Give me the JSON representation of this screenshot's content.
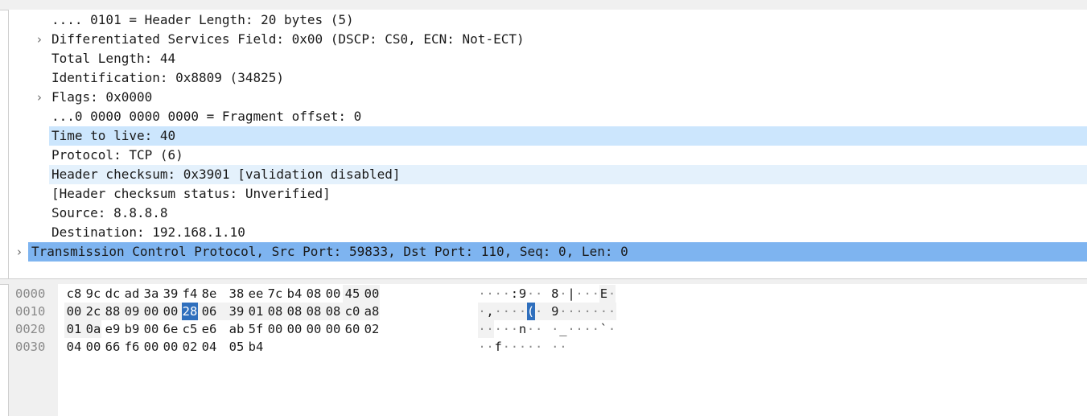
{
  "tree": {
    "rows": [
      {
        "text": ".... 0101 = Header Length: 20 bytes (5)",
        "expandable": false,
        "indent": 1,
        "hl": ""
      },
      {
        "text": "Differentiated Services Field: 0x00 (DSCP: CS0, ECN: Not-ECT)",
        "expandable": true,
        "indent": 1,
        "hl": ""
      },
      {
        "text": "Total Length: 44",
        "expandable": false,
        "indent": 1,
        "hl": ""
      },
      {
        "text": "Identification: 0x8809 (34825)",
        "expandable": false,
        "indent": 1,
        "hl": ""
      },
      {
        "text": "Flags: 0x0000",
        "expandable": true,
        "indent": 1,
        "hl": ""
      },
      {
        "text": "...0 0000 0000 0000 = Fragment offset: 0",
        "expandable": false,
        "indent": 1,
        "hl": ""
      },
      {
        "text": "Time to live: 40",
        "expandable": false,
        "indent": 1,
        "hl": "blue"
      },
      {
        "text": "Protocol: TCP (6)",
        "expandable": false,
        "indent": 1,
        "hl": ""
      },
      {
        "text": "Header checksum: 0x3901 [validation disabled]",
        "expandable": false,
        "indent": 1,
        "hl": "light"
      },
      {
        "text": "[Header checksum status: Unverified]",
        "expandable": false,
        "indent": 1,
        "hl": ""
      },
      {
        "text": "Source: 8.8.8.8",
        "expandable": false,
        "indent": 1,
        "hl": ""
      },
      {
        "text": "Destination: 192.168.1.10",
        "expandable": false,
        "indent": 1,
        "hl": ""
      },
      {
        "text": "Transmission Control Protocol, Src Port: 59833, Dst Port: 110, Seq: 0, Len: 0",
        "expandable": true,
        "indent": 0,
        "hl": "sel"
      }
    ],
    "chevron_icon": "chevron-right-icon",
    "colors": {
      "light": "#e4f1fc",
      "blue": "#cce6fd",
      "sel": "#7eb4f0"
    }
  },
  "hex": {
    "rows": [
      {
        "offset": "0000",
        "bytes": [
          "c8",
          "9c",
          "dc",
          "ad",
          "3a",
          "39",
          "f4",
          "8e",
          "38",
          "ee",
          "7c",
          "b4",
          "08",
          "00",
          "45",
          "00"
        ],
        "ascii": [
          "·",
          "·",
          "·",
          "·",
          ":",
          "9",
          "·",
          "·",
          "8",
          "·",
          "|",
          "·",
          "·",
          "·",
          "E",
          "·"
        ]
      },
      {
        "offset": "0010",
        "bytes": [
          "00",
          "2c",
          "88",
          "09",
          "00",
          "00",
          "28",
          "06",
          "39",
          "01",
          "08",
          "08",
          "08",
          "08",
          "c0",
          "a8"
        ],
        "ascii": [
          "·",
          ",",
          "·",
          "·",
          "·",
          "·",
          "(",
          "·",
          "9",
          "·",
          "·",
          "·",
          "·",
          "·",
          "·",
          "·"
        ]
      },
      {
        "offset": "0020",
        "bytes": [
          "01",
          "0a",
          "e9",
          "b9",
          "00",
          "6e",
          "c5",
          "e6",
          "ab",
          "5f",
          "00",
          "00",
          "00",
          "00",
          "60",
          "02"
        ],
        "ascii": [
          "·",
          "·",
          "·",
          "·",
          "·",
          "n",
          "·",
          "·",
          "·",
          "_",
          "·",
          "·",
          "·",
          "·",
          "`",
          "·"
        ]
      },
      {
        "offset": "0030",
        "bytes": [
          "04",
          "00",
          "66",
          "f6",
          "00",
          "00",
          "02",
          "04",
          "05",
          "b4"
        ],
        "ascii": [
          "·",
          "·",
          "f",
          "·",
          "·",
          "·",
          "·",
          "·",
          "·",
          "·"
        ]
      }
    ],
    "selected": {
      "row": 1,
      "col": 6
    },
    "highlight_ranges": [
      {
        "row": 0,
        "from": 14,
        "to": 15
      },
      {
        "row": 1,
        "from": 0,
        "to": 15
      },
      {
        "row": 2,
        "from": 0,
        "to": 1
      }
    ],
    "selected_color": "#2f6fbd"
  }
}
